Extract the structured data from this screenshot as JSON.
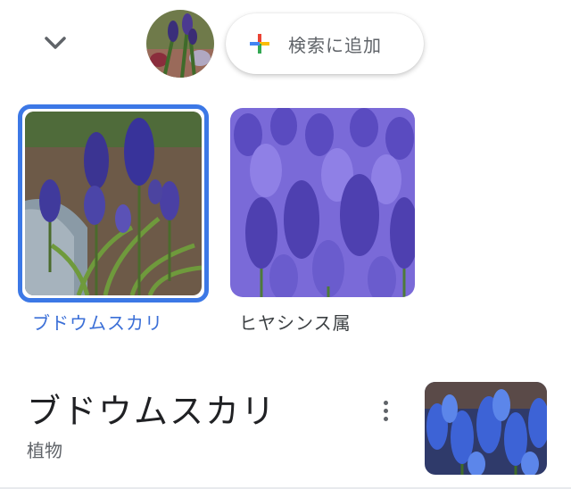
{
  "header": {
    "collapse_icon": "chevron-down-icon",
    "add_to_search": {
      "icon": "plus-icon",
      "label": "検索に追加"
    }
  },
  "results": [
    {
      "label": "ブドウムスカリ",
      "selected": true
    },
    {
      "label": "ヒヤシンス属",
      "selected": false
    }
  ],
  "entity": {
    "title": "ブドウムスカリ",
    "subtitle": "植物",
    "menu_icon": "more-vert-icon"
  },
  "colors": {
    "selection_border": "#3c78e6",
    "selected_label": "#3b6fd7",
    "plus_blue": "#4285f4",
    "plus_red": "#ea4335",
    "plus_yellow": "#fbbc05",
    "plus_green": "#34a853"
  }
}
